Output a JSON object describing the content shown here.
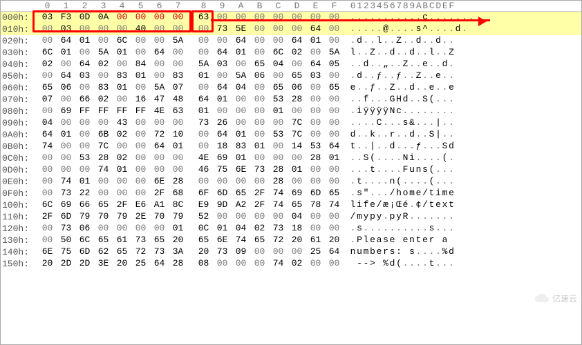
{
  "header": {
    "hexcols": [
      "0",
      "1",
      "2",
      "3",
      "4",
      "5",
      "6",
      "7",
      "8",
      "9",
      "A",
      "B",
      "C",
      "D",
      "E",
      "F"
    ],
    "asccols": [
      "0",
      "1",
      "2",
      "3",
      "4",
      "5",
      "6",
      "7",
      "8",
      "9",
      "A",
      "B",
      "C",
      "D",
      "E",
      "F"
    ]
  },
  "highlight_rows": [
    0,
    1
  ],
  "magic_box_cols": 8,
  "rows": [
    {
      "addr": "000h:",
      "hex": [
        "03",
        "F3",
        "0D",
        "0A",
        "00",
        "00",
        "00",
        "00",
        "63",
        "00",
        "00",
        "00",
        "00",
        "00",
        "00",
        "00"
      ],
      "asc": "...........c......."
    },
    {
      "addr": "010h:",
      "hex": [
        "00",
        "03",
        "00",
        "00",
        "00",
        "40",
        "00",
        "00",
        "00",
        "73",
        "5E",
        "00",
        "00",
        "00",
        "64",
        "00"
      ],
      "asc": ".....@....s^....d."
    },
    {
      "addr": "020h:",
      "hex": [
        "00",
        "64",
        "01",
        "00",
        "6C",
        "00",
        "00",
        "5A",
        "00",
        "00",
        "64",
        "00",
        "00",
        "64",
        "01",
        "00"
      ],
      "asc": ".d..l..Z..d..d.."
    },
    {
      "addr": "030h:",
      "hex": [
        "6C",
        "01",
        "00",
        "5A",
        "01",
        "00",
        "64",
        "00",
        "00",
        "64",
        "01",
        "00",
        "6C",
        "02",
        "00",
        "5A"
      ],
      "asc": "l..Z..d..d..l..Z"
    },
    {
      "addr": "040h:",
      "hex": [
        "02",
        "00",
        "64",
        "02",
        "00",
        "84",
        "00",
        "00",
        "5A",
        "03",
        "00",
        "65",
        "04",
        "00",
        "64",
        "05"
      ],
      "asc": "..d..„..Z..e..d."
    },
    {
      "addr": "050h:",
      "hex": [
        "00",
        "64",
        "03",
        "00",
        "83",
        "01",
        "00",
        "83",
        "01",
        "00",
        "5A",
        "06",
        "00",
        "65",
        "03",
        "00"
      ],
      "asc": ".d..ƒ..ƒ..Z..e.."
    },
    {
      "addr": "060h:",
      "hex": [
        "65",
        "06",
        "00",
        "83",
        "01",
        "00",
        "5A",
        "07",
        "00",
        "64",
        "04",
        "00",
        "65",
        "06",
        "00",
        "65"
      ],
      "asc": "e..ƒ..Z..d..e..e"
    },
    {
      "addr": "070h:",
      "hex": [
        "07",
        "00",
        "66",
        "02",
        "00",
        "16",
        "47",
        "48",
        "64",
        "01",
        "00",
        "00",
        "53",
        "28",
        "00",
        "00"
      ],
      "asc": "..f...GHd..S(..."
    },
    {
      "addr": "080h:",
      "hex": [
        "00",
        "69",
        "FF",
        "FF",
        "FF",
        "FF",
        "4E",
        "63",
        "01",
        "00",
        "00",
        "00",
        "01",
        "00",
        "00",
        "00"
      ],
      "asc": ".iÿÿÿÿNc........"
    },
    {
      "addr": "090h:",
      "hex": [
        "04",
        "00",
        "00",
        "00",
        "43",
        "00",
        "00",
        "00",
        "73",
        "26",
        "00",
        "00",
        "00",
        "7C",
        "00",
        "00"
      ],
      "asc": "....C...s&...|.."
    },
    {
      "addr": "0A0h:",
      "hex": [
        "64",
        "01",
        "00",
        "6B",
        "02",
        "00",
        "72",
        "10",
        "00",
        "64",
        "01",
        "00",
        "53",
        "7C",
        "00",
        "00"
      ],
      "asc": "d..k..r..d..S|.."
    },
    {
      "addr": "0B0h:",
      "hex": [
        "74",
        "00",
        "00",
        "7C",
        "00",
        "00",
        "64",
        "01",
        "00",
        "18",
        "83",
        "01",
        "00",
        "14",
        "53",
        "64"
      ],
      "asc": "t..|..d...ƒ...Sd"
    },
    {
      "addr": "0C0h:",
      "hex": [
        "00",
        "00",
        "53",
        "28",
        "02",
        "00",
        "00",
        "00",
        "4E",
        "69",
        "01",
        "00",
        "00",
        "00",
        "28",
        "01"
      ],
      "asc": "..S(....Ni....(."
    },
    {
      "addr": "0D0h:",
      "hex": [
        "00",
        "00",
        "00",
        "74",
        "01",
        "00",
        "00",
        "00",
        "46",
        "75",
        "6E",
        "73",
        "28",
        "01",
        "00",
        "00"
      ],
      "asc": "...t....Funs(..."
    },
    {
      "addr": "0E0h:",
      "hex": [
        "00",
        "74",
        "01",
        "00",
        "00",
        "00",
        "6E",
        "28",
        "00",
        "00",
        "00",
        "00",
        "28",
        "00",
        "00",
        "00"
      ],
      "asc": ".t....n(....(..."
    },
    {
      "addr": "0F0h:",
      "hex": [
        "00",
        "73",
        "22",
        "00",
        "00",
        "00",
        "2F",
        "68",
        "6F",
        "6D",
        "65",
        "2F",
        "74",
        "69",
        "6D",
        "65"
      ],
      "asc": ".s\".../home/time"
    },
    {
      "addr": "100h:",
      "hex": [
        "6C",
        "69",
        "66",
        "65",
        "2F",
        "E6",
        "A1",
        "8C",
        "E9",
        "9D",
        "A2",
        "2F",
        "74",
        "65",
        "78",
        "74"
      ],
      "asc": "life/æ¡Œé.¢/text"
    },
    {
      "addr": "110h:",
      "hex": [
        "2F",
        "6D",
        "79",
        "70",
        "79",
        "2E",
        "70",
        "79",
        "52",
        "00",
        "00",
        "00",
        "00",
        "04",
        "00",
        "00"
      ],
      "asc": "/mypy.pyR......."
    },
    {
      "addr": "120h:",
      "hex": [
        "00",
        "73",
        "06",
        "00",
        "00",
        "00",
        "00",
        "01",
        "0C",
        "01",
        "04",
        "02",
        "73",
        "18",
        "00",
        "00"
      ],
      "asc": ".s..........s..."
    },
    {
      "addr": "130h:",
      "hex": [
        "00",
        "50",
        "6C",
        "65",
        "61",
        "73",
        "65",
        "20",
        "65",
        "6E",
        "74",
        "65",
        "72",
        "20",
        "61",
        "20"
      ],
      "asc": ".Please enter a "
    },
    {
      "addr": "140h:",
      "hex": [
        "6E",
        "75",
        "6D",
        "62",
        "65",
        "72",
        "73",
        "3A",
        "20",
        "73",
        "09",
        "00",
        "00",
        "00",
        "25",
        "64"
      ],
      "asc": "numbers: s....%d"
    },
    {
      "addr": "150h:",
      "hex": [
        "20",
        "2D",
        "2D",
        "3E",
        "20",
        "25",
        "64",
        "28",
        "08",
        "00",
        "00",
        "00",
        "74",
        "02",
        "00",
        "00"
      ],
      "asc": " --> %d(....t..."
    }
  ],
  "watermark": "亿速云"
}
